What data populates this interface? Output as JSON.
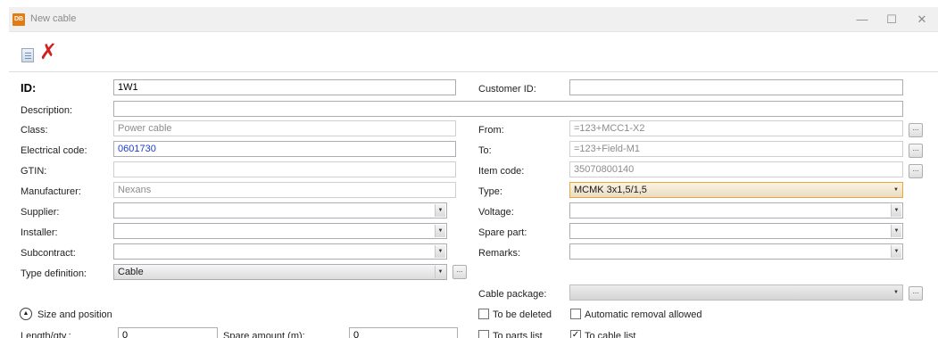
{
  "window": {
    "app_icon_text": "DB",
    "title": "New cable",
    "minimize": "—",
    "maximize": "☐",
    "close": "✕"
  },
  "toolbar": {
    "new_icon": "document-icon",
    "delete_icon": "delete-x-icon",
    "delete_glyph": "✗"
  },
  "form": {
    "id": {
      "label": "ID:",
      "value": "1W1"
    },
    "customer_id": {
      "label": "Customer ID:",
      "value": ""
    },
    "description": {
      "label": "Description:",
      "value": ""
    },
    "class": {
      "label": "Class:",
      "value": "Power cable"
    },
    "electrical_code": {
      "label": "Electrical code:",
      "value": "0601730"
    },
    "gtin": {
      "label": "GTIN:",
      "value": ""
    },
    "manufacturer": {
      "label": "Manufacturer:",
      "value": "Nexans"
    },
    "supplier": {
      "label": "Supplier:",
      "value": ""
    },
    "installer": {
      "label": "Installer:",
      "value": ""
    },
    "subcontract": {
      "label": "Subcontract:",
      "value": ""
    },
    "type_definition": {
      "label": "Type definition:",
      "value": "Cable"
    },
    "from": {
      "label": "From:",
      "value": "=123+MCC1-X2"
    },
    "to": {
      "label": "To:",
      "value": "=123+Field-M1"
    },
    "item_code": {
      "label": "Item code:",
      "value": "35070800140"
    },
    "type": {
      "label": "Type:",
      "value": "MCMK 3x1,5/1,5"
    },
    "voltage": {
      "label": "Voltage:",
      "value": ""
    },
    "spare_part": {
      "label": "Spare part:",
      "value": ""
    },
    "remarks": {
      "label": "Remarks:",
      "value": ""
    },
    "cable_package": {
      "label": "Cable package:",
      "value": ""
    },
    "to_be_deleted": {
      "label": "To be deleted",
      "checked": false
    },
    "automatic_removal": {
      "label": "Automatic removal allowed",
      "checked": false
    },
    "to_parts_list": {
      "label": "To parts list",
      "checked": false
    },
    "to_cable_list": {
      "label": "To cable list",
      "checked": true
    },
    "size_and_position": {
      "label": "Size and position"
    },
    "length_qty": {
      "label": "Length/qty.:",
      "value": "0"
    },
    "spare_amount": {
      "label": "Spare amount (m):",
      "value": "0"
    },
    "ellipsis": "...",
    "dropdown_glyph": "▼",
    "check_glyph": "✓",
    "expand_glyph": "▲"
  }
}
